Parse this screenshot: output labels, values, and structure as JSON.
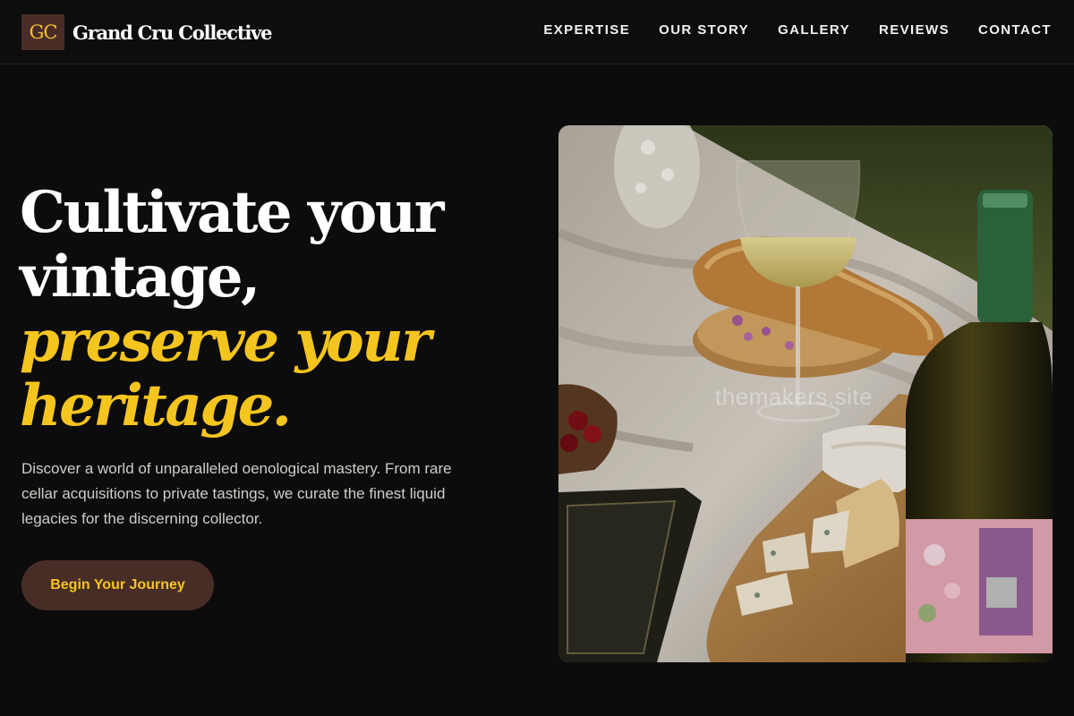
{
  "brand": {
    "mark": "GC",
    "name": "Grand Cru Collective"
  },
  "nav": [
    {
      "label": "EXPERTISE"
    },
    {
      "label": "OUR STORY"
    },
    {
      "label": "GALLERY"
    },
    {
      "label": "REVIEWS"
    },
    {
      "label": "CONTACT"
    }
  ],
  "hero": {
    "line1": "Cultivate your",
    "line2": "vintage,",
    "line3": "preserve your",
    "line4": "heritage.",
    "lead": "Discover a world of unparalleled oenological mastery. From rare cellar acquisitions to private tastings, we curate the finest liquid legacies for the discerning collector.",
    "cta": "Begin Your Journey"
  },
  "image": {
    "watermark": "themakers.site"
  },
  "colors": {
    "background": "#0c0c0c",
    "accent": "#f5c51f",
    "button": "#482d27"
  }
}
